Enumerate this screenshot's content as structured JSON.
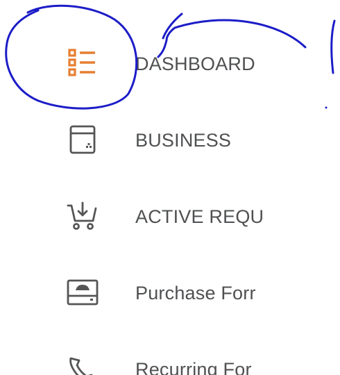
{
  "sidebar": {
    "items": [
      {
        "label": "DASHBOARD",
        "icon": "list-icon",
        "active": true
      },
      {
        "label": "BUSINESS",
        "icon": "archive-box-icon",
        "active": false
      },
      {
        "label": "ACTIVE REQU",
        "icon": "cart-download-icon",
        "active": false
      },
      {
        "label": "Purchase Forr",
        "icon": "inbox-tray-icon",
        "active": false
      },
      {
        "label": "Recurring For",
        "icon": "phone-icon",
        "active": false
      }
    ]
  },
  "colors": {
    "active_icon": "#e67e32",
    "icon": "#555555",
    "label": "#4f5052",
    "annotation": "#1c1cc8"
  }
}
